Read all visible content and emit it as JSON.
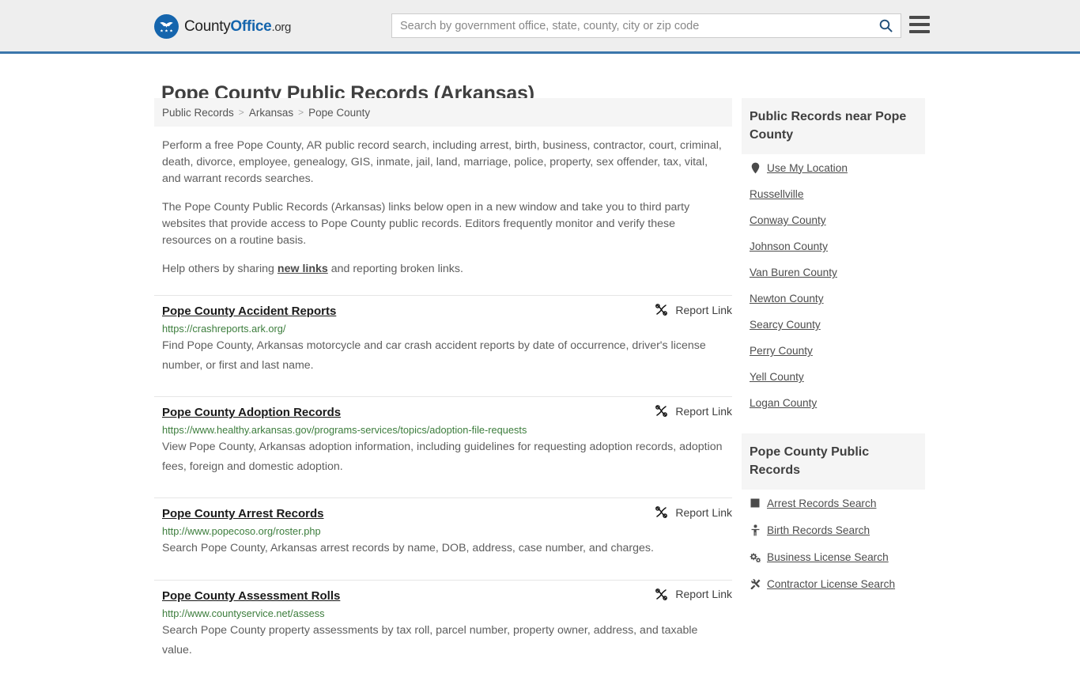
{
  "header": {
    "logo_text_1": "County",
    "logo_text_2": "Office",
    "logo_text_3": ".org",
    "logo_icon": "eagle-shield-stars-icon",
    "search_placeholder": "Search by government office, state, county, city or zip code",
    "search_value": "",
    "search_icon": "search-icon",
    "menu_icon": "hamburger-menu-icon",
    "accent_color": "#3b76ab",
    "background_color": "#eeeeee"
  },
  "page": {
    "title": "Pope County Public Records (Arkansas)"
  },
  "breadcrumb": {
    "items": [
      {
        "label": "Public Records"
      },
      {
        "label": "Arkansas"
      },
      {
        "label": "Pope County"
      }
    ],
    "separator": ">"
  },
  "intro": {
    "paragraph_1": "Perform a free Pope County, AR public record search, including arrest, birth, business, contractor, court, criminal, death, divorce, employee, genealogy, GIS, inmate, jail, land, marriage, police, property, sex offender, tax, vital, and warrant records searches.",
    "paragraph_2": "The Pope County Public Records (Arkansas) links below open in a new window and take you to third party websites that provide access to Pope County public records. Editors frequently monitor and verify these resources on a routine basis.",
    "paragraph_3_before": "Help others by sharing ",
    "paragraph_3_link": "new links",
    "paragraph_3_after": " and reporting broken links."
  },
  "records": {
    "report_label": "Report Link",
    "report_icon": "broken-link-icon",
    "items": [
      {
        "title": "Pope County Accident Reports",
        "url": "https://crashreports.ark.org/",
        "description": "Find Pope County, Arkansas motorcycle and car crash accident reports by date of occurrence, driver's license number, or first and last name."
      },
      {
        "title": "Pope County Adoption Records",
        "url": "https://www.healthy.arkansas.gov/programs-services/topics/adoption-file-requests",
        "description": "View Pope County, Arkansas adoption information, including guidelines for requesting adoption records, adoption fees, foreign and domestic adoption."
      },
      {
        "title": "Pope County Arrest Records",
        "url": "http://www.popecoso.org/roster.php",
        "description": "Search Pope County, Arkansas arrest records by name, DOB, address, case number, and charges."
      },
      {
        "title": "Pope County Assessment Rolls",
        "url": "http://www.countyservice.net/assess",
        "description": "Search Pope County property assessments by tax roll, parcel number, property owner, address, and taxable value."
      }
    ]
  },
  "sidebar": {
    "nearby": {
      "heading": "Public Records near Pope County",
      "items": [
        {
          "label": "Use My Location",
          "icon": "map-pin-icon"
        },
        {
          "label": "Russellville",
          "icon": ""
        },
        {
          "label": "Conway County",
          "icon": ""
        },
        {
          "label": "Johnson County",
          "icon": ""
        },
        {
          "label": "Van Buren County",
          "icon": ""
        },
        {
          "label": "Newton County",
          "icon": ""
        },
        {
          "label": "Searcy County",
          "icon": ""
        },
        {
          "label": "Perry County",
          "icon": ""
        },
        {
          "label": "Yell County",
          "icon": ""
        },
        {
          "label": "Logan County",
          "icon": ""
        }
      ]
    },
    "county_records": {
      "heading": "Pope County Public Records",
      "items": [
        {
          "label": "Arrest Records Search",
          "icon": "handcuffs-icon"
        },
        {
          "label": "Birth Records Search",
          "icon": "baby-icon"
        },
        {
          "label": "Business License Search",
          "icon": "gears-icon"
        },
        {
          "label": "Contractor License Search",
          "icon": "tools-icon"
        }
      ]
    }
  }
}
